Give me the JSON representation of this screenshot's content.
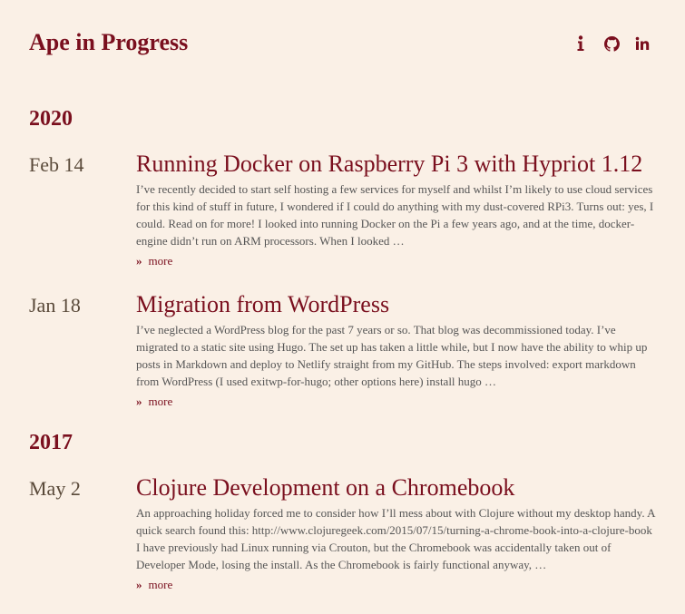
{
  "site": {
    "title": "Ape in Progress"
  },
  "nav": [
    {
      "name": "info-icon",
      "icon": "info"
    },
    {
      "name": "github-icon",
      "icon": "github"
    },
    {
      "name": "linkedin-icon",
      "icon": "linkedin"
    }
  ],
  "colors": {
    "background": "#faf0e6",
    "accent": "#7a0f1e"
  },
  "groups": [
    {
      "year": "2020",
      "posts": [
        {
          "date": "Feb 14",
          "title": "Running Docker on Raspberry Pi 3 with Hypriot 1.12",
          "summary": "I’ve recently decided to start self hosting a few services for myself and whilst I’m likely to use cloud services for this kind of stuff in future, I wondered if I could do anything with my dust-covered RPi3. Turns out: yes, I could. Read on for more! I looked into running Docker on the Pi a few years ago, and at the time, docker-engine didn’t run on ARM processors. When I looked …",
          "more": "more"
        },
        {
          "date": "Jan 18",
          "title": "Migration from WordPress",
          "summary": "I’ve neglected a WordPress blog for the past 7 years or so. That blog was decommissioned today. I’ve migrated to a static site using Hugo. The set up has taken a little while, but I now have the ability to whip up posts in Markdown and deploy to Netlify straight from my GitHub. The steps involved: export markdown from WordPress (I used exitwp-for-hugo; other options here) install hugo …",
          "more": "more"
        }
      ]
    },
    {
      "year": "2017",
      "posts": [
        {
          "date": "May 2",
          "title": "Clojure Development on a Chromebook",
          "summary": "An approaching holiday forced me to consider how I’ll mess about with Clojure without my desktop handy. A quick search found this: http://www.clojuregeek.com/2015/07/15/turning-a-chrome-book-into-a-clojure-book I have previously had Linux running via Crouton, but the Chromebook was accidentally taken out of Developer Mode, losing the install. As the Chromebook is fairly functional anyway, …",
          "more": "more"
        }
      ]
    }
  ]
}
